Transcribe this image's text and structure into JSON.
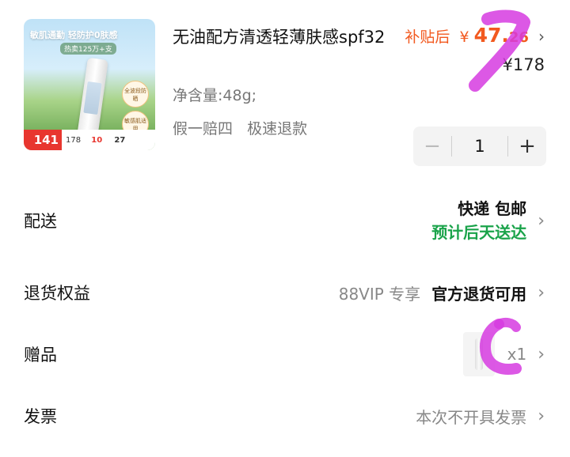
{
  "product": {
    "title": "无油配方清透轻薄肤感spf32",
    "spec": "净含量:48g;",
    "guarantees": [
      "假一赔四",
      "极速退款"
    ],
    "thumb": {
      "headline": "敏肌通勤 轻防护0肤感",
      "sub": "热卖125万+支",
      "badge_a": "全波段防晒",
      "badge_b": "敏感肌适用",
      "price_main": "141",
      "price_rest_a": "178",
      "price_rest_b": "10",
      "price_rest_c": "27"
    }
  },
  "price": {
    "subsidy_label": "补贴后",
    "currency": "¥",
    "subsidy_int": "47.",
    "subsidy_dec": "26",
    "original": "¥178"
  },
  "quantity": {
    "value": "1",
    "minus": "−",
    "plus": "+"
  },
  "rows": {
    "delivery": {
      "label": "配送",
      "method": "快递 包邮",
      "eta": "预计后天送达"
    },
    "returns": {
      "label": "退货权益",
      "vip": "88VIP 专享",
      "value": "官方退货可用"
    },
    "gift": {
      "label": "赠品",
      "qty": "x1"
    },
    "invoice": {
      "label": "发票",
      "value": "本次不开具发票"
    },
    "chevron": "›"
  },
  "colors": {
    "accent_orange": "#f2591f",
    "eta_green": "#1aa34a",
    "annotation_magenta": "#d63be0"
  }
}
